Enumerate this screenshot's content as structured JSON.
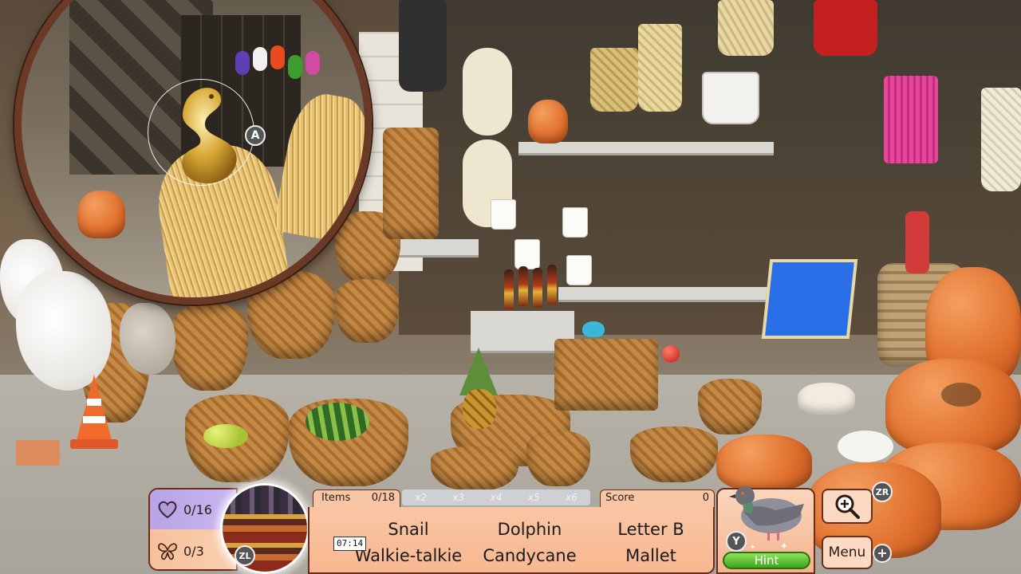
{
  "magnifier": {
    "button_a": "A"
  },
  "stats": {
    "hearts": "0/16",
    "butterflies": "0/3",
    "zl_button": "ZL"
  },
  "items": {
    "label": "Items",
    "count": "0/18",
    "multipliers": [
      "x2",
      "x3",
      "x4",
      "x5",
      "x6"
    ],
    "words": [
      "Snail",
      "Dolphin",
      "Letter B",
      "Walkie-talkie",
      "Candycane",
      "Mallet"
    ]
  },
  "score": {
    "label": "Score",
    "value": "0"
  },
  "timer": "07:14",
  "hint": {
    "label": "Hint",
    "button": "Y"
  },
  "controls": {
    "zoom_button": "ZR",
    "menu_label": "Menu",
    "plus_button": "+"
  },
  "icons": {
    "heart": "heart-icon",
    "butterfly": "butterfly-icon",
    "zoom": "magnifier-plus-icon"
  },
  "colors": {
    "hud_bg": "#f7c6a5",
    "hud_border": "#6a2d1c",
    "stat_top_bg": "#c9b6f0",
    "hint_bar": "#3ea51c"
  }
}
